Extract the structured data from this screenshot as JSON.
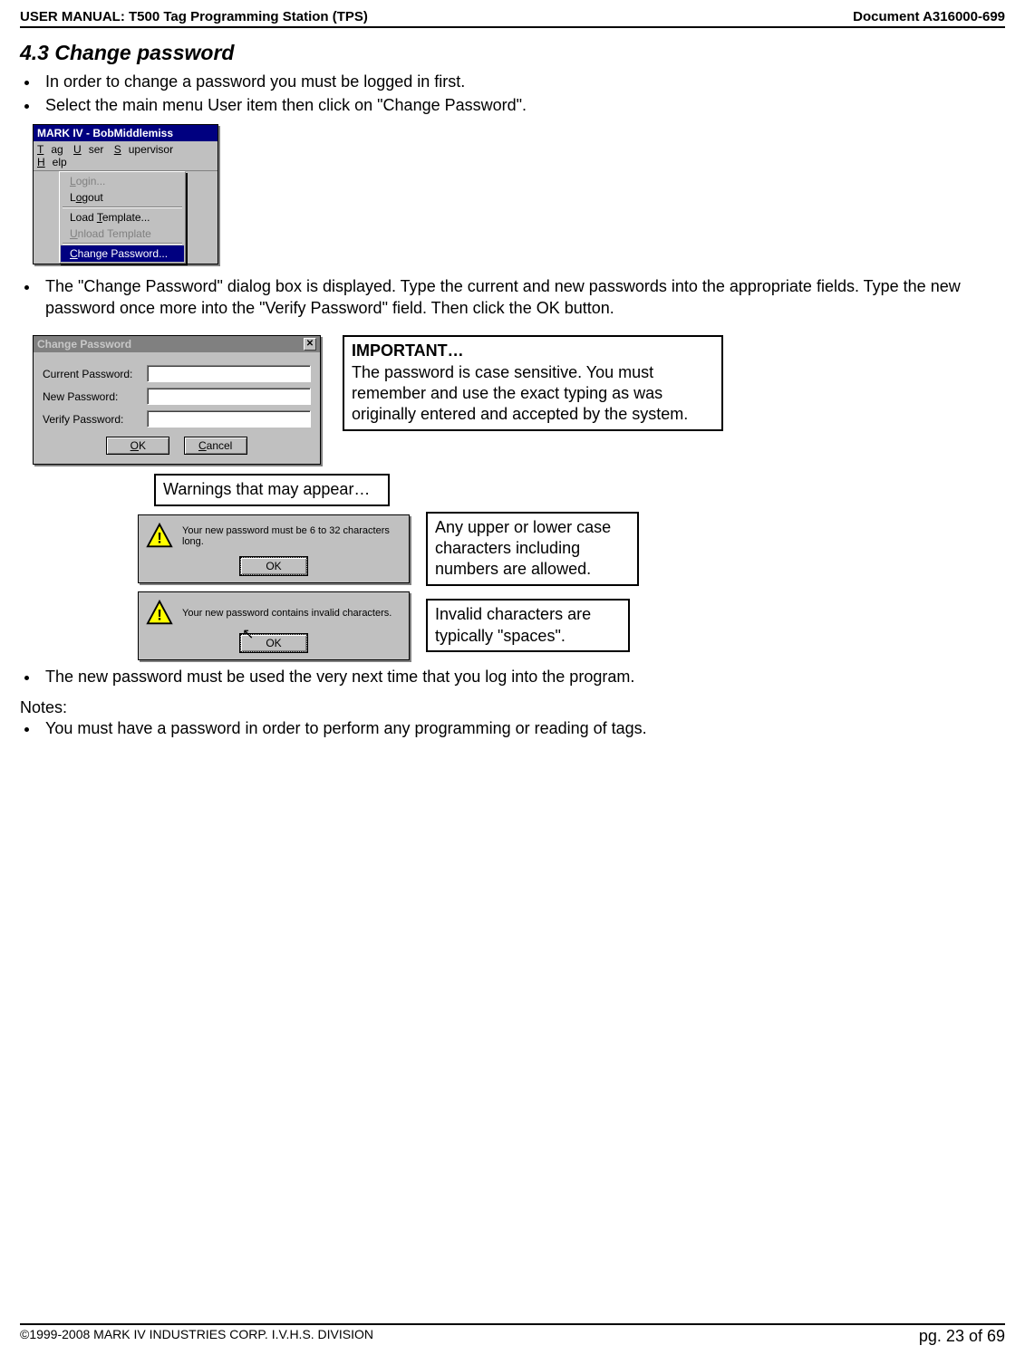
{
  "header": {
    "left": "USER MANUAL: T500 Tag Programming Station (TPS)",
    "right": "Document A316000-699"
  },
  "section_heading": "4.3 Change password",
  "bullets_top": [
    "In order to change a password you must be logged in first.",
    "Select the main menu User item then click on \"Change Password\"."
  ],
  "menu_window": {
    "title": "MARK IV - BobMiddlemiss",
    "menubar": {
      "tag": "Tag",
      "user": "User",
      "supervisor": "Supervisor",
      "help": "Help"
    },
    "items": {
      "login": "Login...",
      "logout": "Logout",
      "load_template": "Load Template...",
      "unload_template": "Unload Template",
      "change_password": "Change Password..."
    }
  },
  "bullet_mid": "The \"Change Password\" dialog box is displayed. Type the current and new passwords into the appropriate fields. Type the new password once more into the \"Verify Password\" field.  Then click the OK button.",
  "change_dialog": {
    "title": "Change Password",
    "labels": {
      "current": "Current Password:",
      "new": "New Password:",
      "verify": "Verify Password:"
    },
    "buttons": {
      "ok": "OK",
      "cancel": "Cancel"
    }
  },
  "important_box": {
    "heading": "IMPORTANT…",
    "body": "The password is case sensitive. You must remember and use the exact typing as was originally entered and accepted by the system."
  },
  "warnings_label": "Warnings that may appear…",
  "warning1": {
    "text": "Your new password must be 6 to 32 characters long.",
    "ok": "OK"
  },
  "warning1_note": "Any upper or lower case characters including numbers are allowed.",
  "warning2": {
    "text": "Your new password contains invalid characters.",
    "ok": "OK"
  },
  "warning2_note": "Invalid characters are typically \"spaces\".",
  "bullet_after": "The new password must be used the very next time that you log into the program.",
  "notes_label": "Notes:",
  "notes_bullet": "You must have a password in order to perform any programming or reading of tags.",
  "footer": {
    "left_copyright": "©1999-2008 MARK IV INDUSTRIES CORP. ",
    "left_division": "I.V.H.S. DIVISION",
    "right": "pg. 23 of 69"
  }
}
